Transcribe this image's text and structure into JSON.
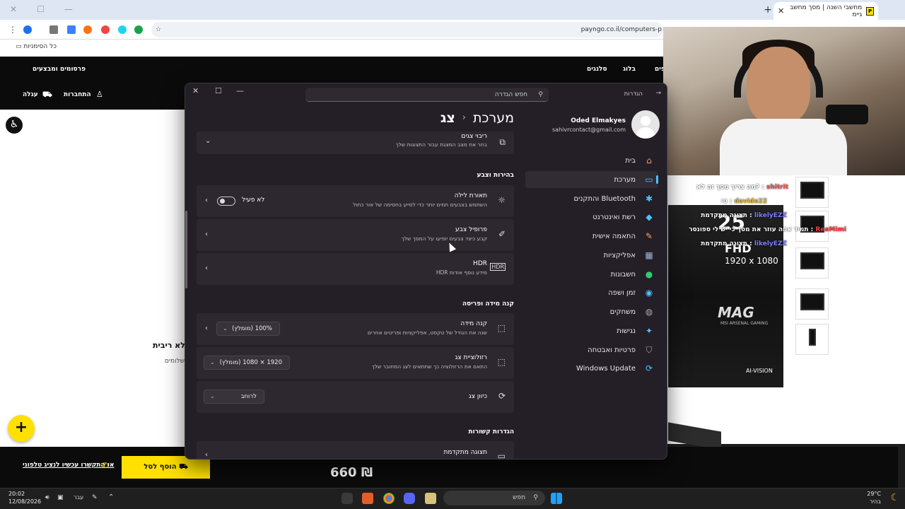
{
  "browser": {
    "tab_title": "מחשבי השנה | מסך מחשב גיימ",
    "url": "payngo.co.il/computers-p",
    "bookmarks_label": "כל הסימניות"
  },
  "site": {
    "nav_links": [
      "פרסומים ומבצעים",
      "סלנגים",
      "בלוג",
      "פים"
    ],
    "login_label": "התחברות",
    "cart_label": "עגלה",
    "fragment_title": "לא ריבית)",
    "fragment_sub": "תשלומים",
    "add_to_cart": "הוסף לסל",
    "price": "660 ₪",
    "phone_cta": "או התקשרו עכשיו לנציג טלפוני"
  },
  "banner": {
    "size": "25",
    "fhd": "FHD",
    "resolution": "1920 x 1080",
    "brand": "MAG",
    "sub": "MSI ARSENAL GAMING",
    "ai": "AI-VISION"
  },
  "chat": [
    {
      "user": "shitrit",
      "msg": "מה צריך מסך זה לא?",
      "color": "#ff4b4b"
    },
    {
      "user": "davide22",
      "msg": "טי",
      "color": "#e0b03c"
    },
    {
      "user": "likelyEZZ",
      "msg": "תצוגה מתקדמת",
      "color": "#7b7bff"
    },
    {
      "user": "ReaMimi",
      "msg": "תמיד אחה עוזר את מסך כי יש לי ספונסר",
      "color": "#ff3b3b"
    },
    {
      "user": "likelyEZZ",
      "msg": "תצוגה מתקדמת",
      "color": "#7b7bff"
    }
  ],
  "settings": {
    "window_title": "הגדרות",
    "search_placeholder": "חפש הגדרה",
    "breadcrumb_parent": "מערכת",
    "breadcrumb_current": "צג",
    "user_name": "Oded Elmakyes",
    "user_email": "sahivrcontact@gmail.com",
    "nav": [
      {
        "label": "בית",
        "icon": "home-icon",
        "glyph": "⌂",
        "color": "#f4a261"
      },
      {
        "label": "מערכת",
        "icon": "monitor-icon",
        "glyph": "▭",
        "color": "#4cc2ff"
      },
      {
        "label": "Bluetooth והתקנים",
        "icon": "bluetooth-icon",
        "glyph": "✱",
        "color": "#4cc2ff"
      },
      {
        "label": "רשת ואינטרנט",
        "icon": "wifi-icon",
        "glyph": "◆",
        "color": "#4cc2ff"
      },
      {
        "label": "התאמה אישית",
        "icon": "brush-icon",
        "glyph": "✎",
        "color": "#f4a261"
      },
      {
        "label": "אפליקציות",
        "icon": "apps-icon",
        "glyph": "▦",
        "color": "#9fb7d4"
      },
      {
        "label": "חשבונות",
        "icon": "account-icon",
        "glyph": "●",
        "color": "#2ecc71"
      },
      {
        "label": "זמן ושפה",
        "icon": "globe-icon",
        "glyph": "◉",
        "color": "#4cc2ff"
      },
      {
        "label": "משחקים",
        "icon": "gamepad-icon",
        "glyph": "◍",
        "color": "#aaa"
      },
      {
        "label": "נגישות",
        "icon": "accessibility-icon",
        "glyph": "✦",
        "color": "#4cc2ff"
      },
      {
        "label": "פרטיות ואבטחה",
        "icon": "shield-icon",
        "glyph": "⛉",
        "color": "#aaa"
      },
      {
        "label": "Windows Update",
        "icon": "update-icon",
        "glyph": "⟳",
        "color": "#4cc2ff"
      }
    ],
    "multi_title": "ריבוי צגים",
    "multi_sub": "בחר את מצב המצגת עבור התצוגות שלך",
    "sec_brightness": "בהירות וצבע",
    "night_title": "תאורת לילה",
    "night_sub": "השתמש בצבעים חמים יותר כדי לסייע בחסימה של אור כחול",
    "night_state": "לא פעיל",
    "color_title": "פרופיל צבע",
    "color_sub": "קבע כיצד צבעים יופיעו על המסך שלך",
    "hdr_title": "HDR",
    "hdr_sub": "מידע נוסף אודות HDR",
    "sec_scale": "קנה מידה ופריסה",
    "scale_title": "קנה מידה",
    "scale_sub": "שנה את הגודל של טקסט, אפליקציות ופריטים אחרים",
    "scale_value": "100% (מומלץ)",
    "res_title": "רזולוציית צג",
    "res_sub": "התאם את הרזולוציה כך שתתאים לצג המחובר שלך",
    "res_value": "1920 × 1080 (מומלץ)",
    "orient_title": "כיוון צג",
    "orient_value": "לרוחב",
    "sec_related": "הגדרות קשורות",
    "adv_title": "תצוגה מתקדמת"
  },
  "taskbar": {
    "time": "20:02",
    "date": "12/08/2026",
    "lang": "עבר",
    "search": "חפש",
    "temp": "29°C",
    "weather": "בהיר"
  }
}
